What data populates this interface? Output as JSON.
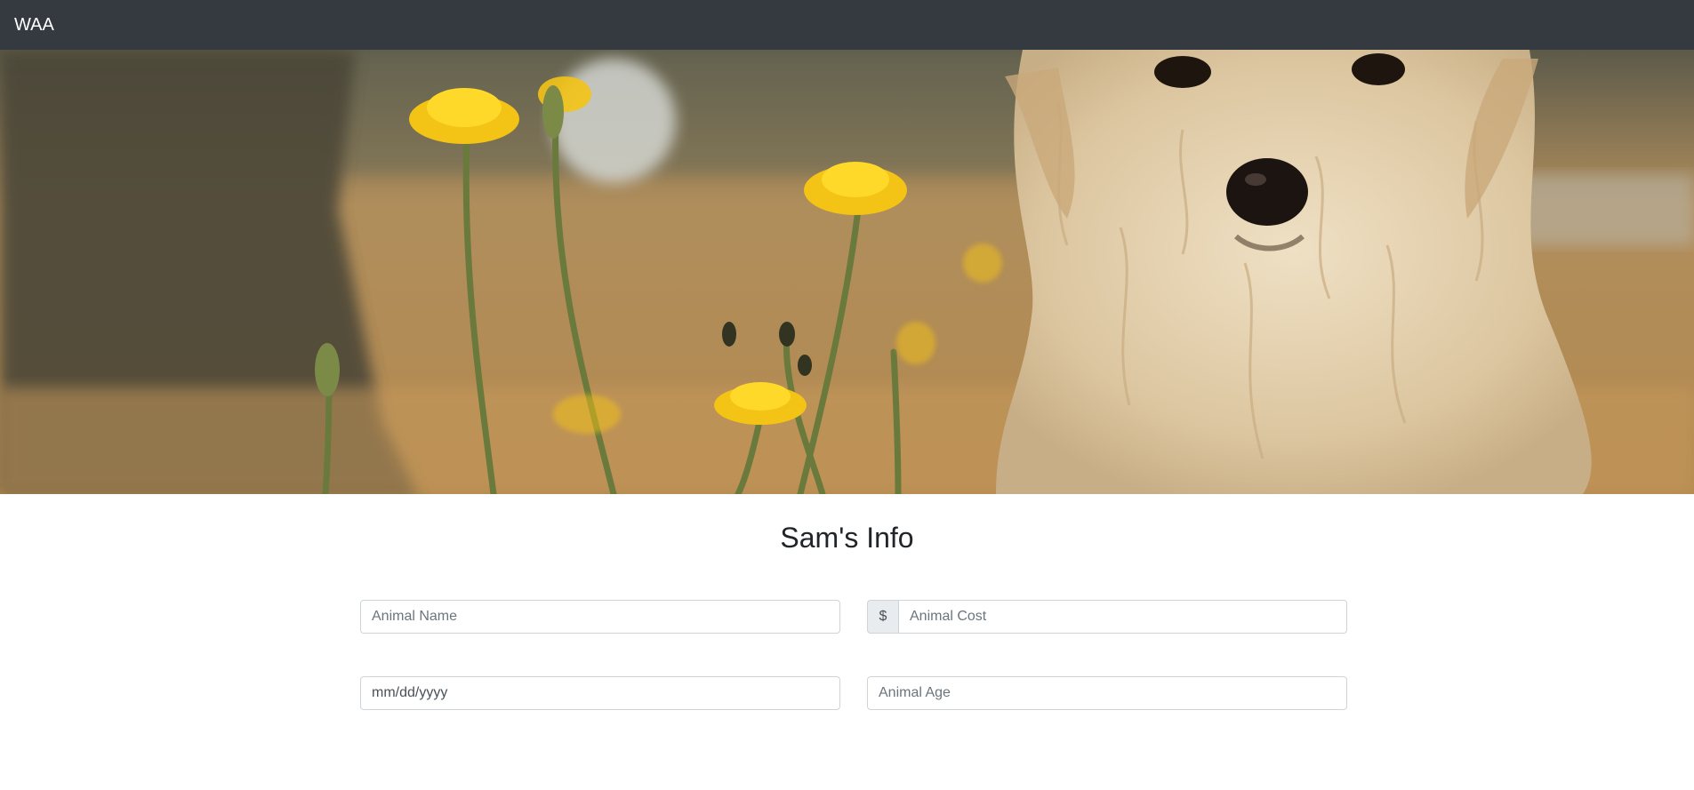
{
  "navbar": {
    "brand": "WAA"
  },
  "hero": {
    "image": "puppy-in-dandelion-field"
  },
  "main": {
    "title": "Sam's Info"
  },
  "form": {
    "name": {
      "placeholder": "Animal Name",
      "value": ""
    },
    "cost": {
      "prefix": "$",
      "placeholder": "Animal Cost",
      "value": ""
    },
    "birthdate": {
      "display": "mm/dd/yyyy",
      "value": ""
    },
    "age": {
      "placeholder": "Animal Age",
      "value": ""
    }
  },
  "colors": {
    "navbar": "#343a40",
    "border": "#ced4da",
    "addon_bg": "#e9ecef",
    "placeholder": "#6c757d"
  }
}
